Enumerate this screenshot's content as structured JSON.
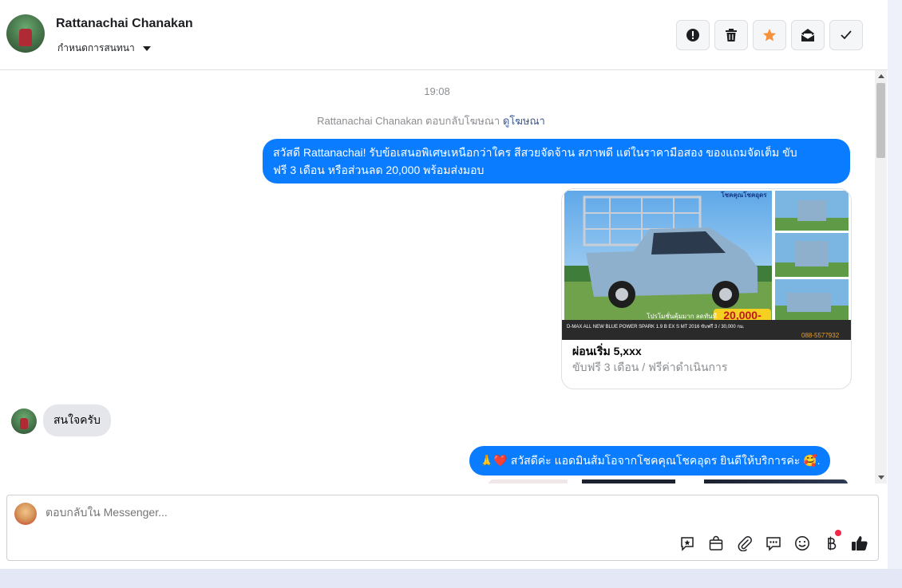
{
  "header": {
    "contact_name": "Rattanachai Chanakan",
    "assign_label": "กำหนดการสนทนา",
    "buttons": [
      "report-icon",
      "trash-icon",
      "star-icon",
      "mark-unread-icon",
      "check-icon"
    ]
  },
  "thread": {
    "timestamp": "19:08",
    "meta_text": "Rattanachai Chanakan ตอบกลับโฆษณา",
    "meta_link": "ดูโฆษณา",
    "outgoing_1_line1": "สวัสดี Rattanachai! รับข้อเสนอพิเศษเหนือกว่าใคร สีสวยจัดจ้าน สภาพดี แต่ในราคามือสอง ของแถมจัดเต็ม ขับ",
    "outgoing_1_line2": "ฟรี 3 เดือน หรือส่วนลด 20,000 พร้อมส่งมอบ",
    "ad_card": {
      "title": "ผ่อนเริ่ม 5,xxx",
      "subtitle": "ขับฟรี 3 เดือน / ฟรีค่าดำเนินการ",
      "image_badge": "20,000-",
      "image_promo": "โปรโมชั่นคุ้มมาก ลดทันที",
      "image_brand": "โชคคุณโชคอุดร",
      "image_phone": "088-5577932",
      "image_spec": "D-MAX ALL NEW BLUE POWER SPARK 1.9 B EX S MT 2016 ขับฟรี 3 / 30,000 กม."
    },
    "incoming_1": "สนใจครับ",
    "outgoing_2": "🙏❤️ สวัสดีค่ะ แอดมินส้มโอจากโชคคุณโชคอุดร ยินดีให้บริการค่ะ 🥰."
  },
  "composer": {
    "placeholder": "ตอบกลับใน Messenger...",
    "tools": [
      "saved-reply-icon",
      "shop-bag-icon",
      "attachment-icon",
      "chat-bubbles-icon",
      "emoji-icon",
      "baht-payment-icon",
      "thumbs-up-icon"
    ]
  },
  "colors": {
    "accent": "#0a7cff",
    "star": "#f7923b",
    "badge_dot": "#f02849"
  }
}
